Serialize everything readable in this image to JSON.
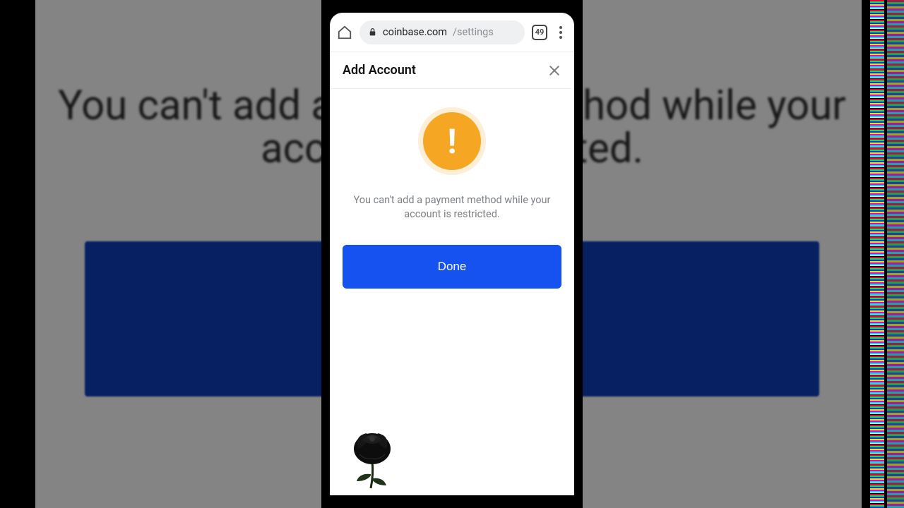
{
  "background": {
    "heading": "You can't add a payment method while your account is restricted."
  },
  "browser": {
    "tab_count": "49",
    "url_domain": "coinbase.com",
    "url_path": "/settings"
  },
  "modal": {
    "title": "Add Account",
    "message": "You can't add a payment method while your account is restricted.",
    "done_label": "Done"
  },
  "colors": {
    "primary": "#1652f0",
    "warning": "#f5a623"
  }
}
